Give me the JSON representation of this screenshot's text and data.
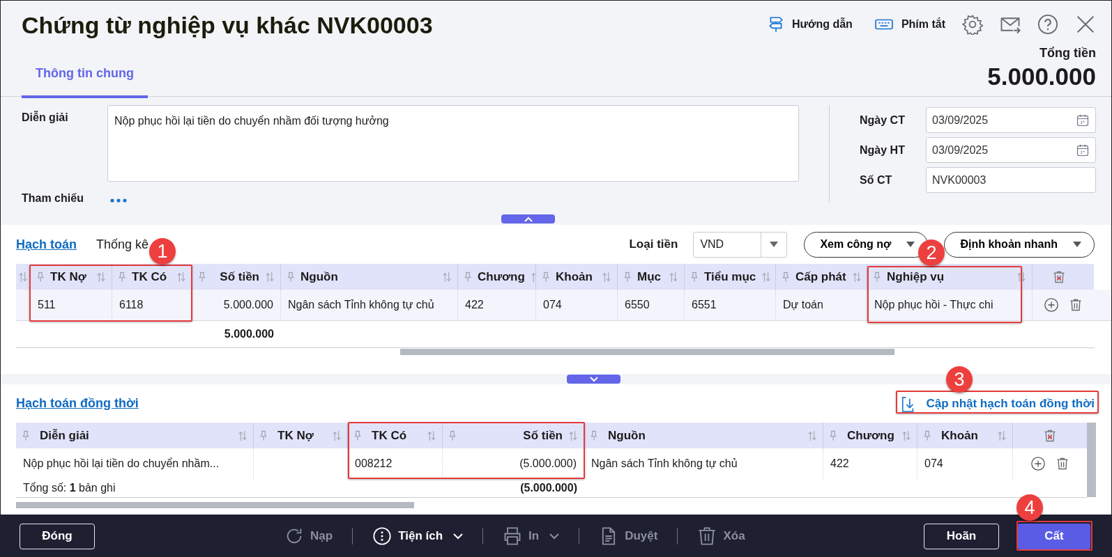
{
  "window": {
    "title": "Chứng từ nghiệp vụ khác NVK00003"
  },
  "toolbar": [
    {
      "kind": "guide",
      "label": "Hướng dẫn"
    },
    {
      "kind": "keyboard",
      "label": "Phím tắt"
    },
    {
      "kind": "settings"
    },
    {
      "kind": "mail"
    },
    {
      "kind": "help"
    },
    {
      "kind": "close"
    }
  ],
  "total": {
    "label": "Tổng tiền",
    "value": "5.000.000"
  },
  "tabs": [
    {
      "label": "Thông tin chung",
      "selected": true
    }
  ],
  "form": {
    "description": {
      "label": "Diễn giải",
      "value": "Nộp phục hồi lại tiền do chuyển nhầm đối tượng hưởng"
    },
    "reference": {
      "label": "Tham chiếu"
    },
    "fields": [
      {
        "label": "Ngày CT",
        "value": "03/09/2025",
        "kind": "date"
      },
      {
        "label": "Ngày HT",
        "value": "03/09/2025",
        "kind": "date"
      },
      {
        "label": "Số CT",
        "value": "NVK00003",
        "kind": "text"
      }
    ]
  },
  "accounting": {
    "tabs": [
      {
        "label": "Hạch toán",
        "selected": true
      },
      {
        "label": "Thống kê",
        "selected": false
      }
    ],
    "currency": {
      "label": "Loại tiền",
      "value": "VND"
    },
    "buttons": [
      {
        "label": "Xem công nợ"
      },
      {
        "label": "Định khoản nhanh"
      }
    ],
    "table": {
      "columns": [
        {
          "label": "TK Nợ",
          "kind": "text"
        },
        {
          "label": "TK Có",
          "kind": "text"
        },
        {
          "label": "Số tiền",
          "kind": "amount"
        },
        {
          "label": "Nguồn",
          "kind": "text"
        },
        {
          "label": "Chương",
          "kind": "text"
        },
        {
          "label": "Khoản",
          "kind": "text"
        },
        {
          "label": "Mục",
          "kind": "text"
        },
        {
          "label": "Tiểu mục",
          "kind": "text"
        },
        {
          "label": "Cấp phát",
          "kind": "text"
        },
        {
          "label": "Nghiệp vụ",
          "kind": "text"
        }
      ],
      "rows": [
        [
          "511",
          "6118",
          "5.000.000",
          "Ngân sách Tỉnh không tự chủ",
          "422",
          "074",
          "6550",
          "6551",
          "Dự toán",
          "Nộp phục hồi - Thực chi"
        ]
      ],
      "total": "5.000.000"
    }
  },
  "concurrent": {
    "title": "Hạch toán đồng thời",
    "update_link": "Cập nhật hạch toán đồng thời",
    "table": {
      "columns": [
        {
          "label": "Diễn giải",
          "kind": "text"
        },
        {
          "label": "TK Nợ",
          "kind": "text"
        },
        {
          "label": "TK Có",
          "kind": "text"
        },
        {
          "label": "Số tiền",
          "kind": "amount"
        },
        {
          "label": "Nguồn",
          "kind": "text"
        },
        {
          "label": "Chương",
          "kind": "text"
        },
        {
          "label": "Khoản",
          "kind": "text"
        }
      ],
      "rows": [
        [
          "Nộp phục hồi lại tiền do chuyển nhầm...",
          null,
          "008212",
          "(5.000.000)",
          "Ngân sách Tỉnh không tự chủ",
          "422",
          "074"
        ]
      ],
      "summary": "Tổng số: **1** bản ghi",
      "total": "(5.000.000)"
    }
  },
  "footer": {
    "close": "Đóng",
    "actions": [
      {
        "kind": "reload",
        "label": "Nạp",
        "disabled": true
      },
      {
        "kind": "utilities",
        "label": "Tiện ích",
        "disabled": false
      },
      {
        "kind": "print",
        "label": "In",
        "disabled": true
      },
      {
        "kind": "approve",
        "label": "Duyệt",
        "disabled": true
      },
      {
        "kind": "delete",
        "label": "Xóa",
        "disabled": true
      }
    ],
    "postpone": "Hoãn",
    "save": "Cất"
  },
  "callouts": [
    {
      "number": "1"
    },
    {
      "number": "2"
    },
    {
      "number": "3"
    },
    {
      "number": "4"
    }
  ]
}
